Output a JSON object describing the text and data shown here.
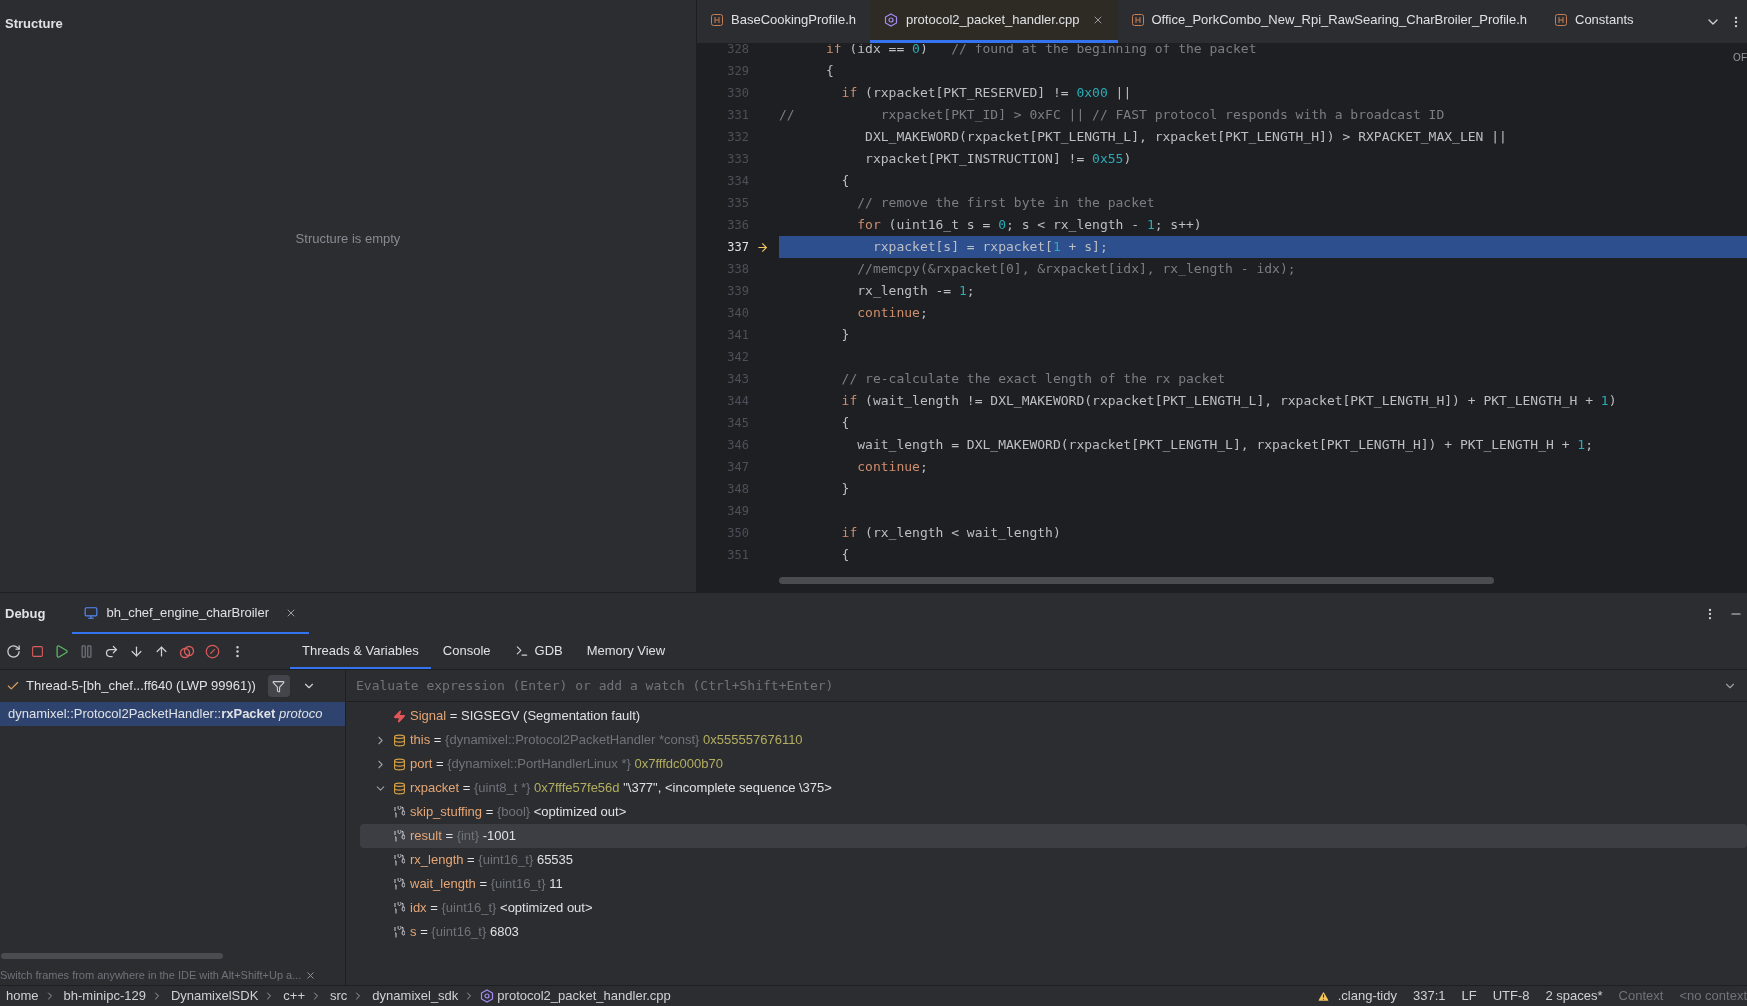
{
  "structure": {
    "title": "Structure",
    "empty_text": "Structure is empty"
  },
  "editor": {
    "tabs": [
      {
        "label": "BaseCookingProfile.h",
        "kind": "header",
        "selected": false,
        "closable": false
      },
      {
        "label": "protocol2_packet_handler.cpp",
        "kind": "source",
        "selected": true,
        "closable": true
      },
      {
        "label": "Office_PorkCombo_New_Rpi_RawSearing_CharBroiler_Profile.h",
        "kind": "header",
        "selected": false,
        "closable": false
      },
      {
        "label": "Constants",
        "kind": "header",
        "selected": false,
        "closable": false
      }
    ],
    "corner_label": "OF",
    "lines": [
      {
        "number": "328",
        "current": false,
        "tokens": [
          {
            "kind": "kw",
            "text": "      if"
          },
          {
            "kind": "plain",
            "text": " (idx == "
          },
          {
            "kind": "num",
            "text": "0"
          },
          {
            "kind": "plain",
            "text": ")   "
          },
          {
            "kind": "comment",
            "text": "// found at the beginning of the packet"
          }
        ]
      },
      {
        "number": "329",
        "current": false,
        "tokens": [
          {
            "kind": "plain",
            "text": "      {"
          }
        ]
      },
      {
        "number": "330",
        "current": false,
        "tokens": [
          {
            "kind": "kw",
            "text": "        if"
          },
          {
            "kind": "plain",
            "text": " (rxpacket[PKT_RESERVED] != "
          },
          {
            "kind": "num",
            "text": "0x00"
          },
          {
            "kind": "plain",
            "text": " ||"
          }
        ]
      },
      {
        "number": "331",
        "current": false,
        "tokens": [
          {
            "kind": "comment",
            "text": "//           rxpacket[PKT_ID] > 0xFC || // FAST protocol responds with a broadcast ID"
          }
        ]
      },
      {
        "number": "332",
        "current": false,
        "tokens": [
          {
            "kind": "plain",
            "text": "           DXL_MAKEWORD(rxpacket[PKT_LENGTH_L], rxpacket[PKT_LENGTH_H]) > RXPACKET_MAX_LEN ||"
          }
        ]
      },
      {
        "number": "333",
        "current": false,
        "tokens": [
          {
            "kind": "plain",
            "text": "           rxpacket[PKT_INSTRUCTION] != "
          },
          {
            "kind": "num",
            "text": "0x55"
          },
          {
            "kind": "plain",
            "text": ")"
          }
        ]
      },
      {
        "number": "334",
        "current": false,
        "tokens": [
          {
            "kind": "plain",
            "text": "        {"
          }
        ]
      },
      {
        "number": "335",
        "current": false,
        "tokens": [
          {
            "kind": "comment",
            "text": "          // remove the first byte in the packet"
          }
        ]
      },
      {
        "number": "336",
        "current": false,
        "tokens": [
          {
            "kind": "kw",
            "text": "          for"
          },
          {
            "kind": "plain",
            "text": " (uint16_t s = "
          },
          {
            "kind": "num",
            "text": "0"
          },
          {
            "kind": "plain",
            "text": "; s < rx_length - "
          },
          {
            "kind": "num",
            "text": "1"
          },
          {
            "kind": "plain",
            "text": "; s++)"
          }
        ]
      },
      {
        "number": "337",
        "current": true,
        "tokens": [
          {
            "kind": "plain",
            "text": "            rxpacket[s] = rxpacket["
          },
          {
            "kind": "num",
            "text": "1"
          },
          {
            "kind": "plain",
            "text": " + s];"
          }
        ]
      },
      {
        "number": "338",
        "current": false,
        "tokens": [
          {
            "kind": "comment",
            "text": "          //memcpy(&rxpacket[0], &rxpacket[idx], rx_length - idx);"
          }
        ]
      },
      {
        "number": "339",
        "current": false,
        "tokens": [
          {
            "kind": "plain",
            "text": "          rx_length -= "
          },
          {
            "kind": "num",
            "text": "1"
          },
          {
            "kind": "plain",
            "text": ";"
          }
        ]
      },
      {
        "number": "340",
        "current": false,
        "tokens": [
          {
            "kind": "kw",
            "text": "          continue"
          },
          {
            "kind": "plain",
            "text": ";"
          }
        ]
      },
      {
        "number": "341",
        "current": false,
        "tokens": [
          {
            "kind": "plain",
            "text": "        }"
          }
        ]
      },
      {
        "number": "342",
        "current": false
      },
      {
        "number": "343",
        "current": false,
        "tokens": [
          {
            "kind": "comment",
            "text": "        // re-calculate the exact length of the rx packet"
          }
        ]
      },
      {
        "number": "344",
        "current": false,
        "tokens": [
          {
            "kind": "kw",
            "text": "        if"
          },
          {
            "kind": "plain",
            "text": " (wait_length != DXL_MAKEWORD(rxpacket[PKT_LENGTH_L], rxpacket[PKT_LENGTH_H]) + PKT_LENGTH_H + "
          },
          {
            "kind": "num",
            "text": "1"
          },
          {
            "kind": "plain",
            "text": ")"
          }
        ]
      },
      {
        "number": "345",
        "current": false,
        "tokens": [
          {
            "kind": "plain",
            "text": "        {"
          }
        ]
      },
      {
        "number": "346",
        "current": false,
        "tokens": [
          {
            "kind": "plain",
            "text": "          wait_length = DXL_MAKEWORD(rxpacket[PKT_LENGTH_L], rxpacket[PKT_LENGTH_H]) + PKT_LENGTH_H + "
          },
          {
            "kind": "num",
            "text": "1"
          },
          {
            "kind": "plain",
            "text": ";"
          }
        ]
      },
      {
        "number": "347",
        "current": false,
        "tokens": [
          {
            "kind": "kw",
            "text": "          continue"
          },
          {
            "kind": "plain",
            "text": ";"
          }
        ]
      },
      {
        "number": "348",
        "current": false,
        "tokens": [
          {
            "kind": "plain",
            "text": "        }"
          }
        ]
      },
      {
        "number": "349",
        "current": false
      },
      {
        "number": "350",
        "current": false,
        "tokens": [
          {
            "kind": "kw",
            "text": "        if"
          },
          {
            "kind": "plain",
            "text": " (rx_length < wait_length)"
          }
        ]
      },
      {
        "number": "351",
        "current": false,
        "tokens": [
          {
            "kind": "plain",
            "text": "        {"
          }
        ]
      }
    ]
  },
  "debug": {
    "title": "Debug",
    "session_tab": {
      "label": "bh_chef_engine_charBroiler",
      "selected": true
    },
    "view_tabs": [
      {
        "label": "Threads & Variables",
        "selected": true,
        "kind": "plain"
      },
      {
        "label": "Console",
        "selected": false,
        "kind": "plain"
      },
      {
        "label": "GDB",
        "selected": false,
        "kind": "terminal"
      },
      {
        "label": "Memory View",
        "selected": false,
        "kind": "plain"
      }
    ],
    "thread": {
      "label": "Thread-5-[bh_chef...ff640 (LWP 99961))"
    },
    "frames": [
      {
        "text": "dynamixel::Protocol2PacketHandler::**rxPacket** *protoco*",
        "selected": true
      }
    ],
    "evaluate_placeholder": "Evaluate expression (Enter) or add a watch (Ctrl+Shift+Enter)",
    "variables": [
      {
        "kind": "signal",
        "name": "Signal",
        "operator": "=",
        "value": "SIGSEGV (Segmentation fault)",
        "selected": false
      },
      {
        "kind": "pointer",
        "name": "this",
        "operator": "=",
        "type": "{dynamixel::Protocol2PacketHandler *const}",
        "value": "0x555557676110",
        "expanded": false,
        "selected": false
      },
      {
        "kind": "pointer",
        "name": "port",
        "operator": "=",
        "type": "{dynamixel::PortHandlerLinux *}",
        "value": "0x7fffdc000b70",
        "expanded": false,
        "selected": false
      },
      {
        "kind": "pointer",
        "name": "rxpacket",
        "operator": "=",
        "type": "{uint8_t *}",
        "value": "0x7fffe57fe56d",
        "extra": "\"\\377\", <incomplete sequence \\375>",
        "expanded": true,
        "selected": false
      },
      {
        "kind": "primitive",
        "name": "skip_stuffing",
        "operator": "=",
        "type": "{bool}",
        "value": "<optimized out>",
        "selected": false
      },
      {
        "kind": "primitive",
        "name": "result",
        "operator": "=",
        "type": "{int}",
        "value": "-1001",
        "selected": true
      },
      {
        "kind": "primitive",
        "name": "rx_length",
        "operator": "=",
        "type": "{uint16_t}",
        "value": "65535",
        "selected": false
      },
      {
        "kind": "primitive",
        "name": "wait_length",
        "operator": "=",
        "type": "{uint16_t}",
        "value": "11",
        "selected": false
      },
      {
        "kind": "primitive",
        "name": "idx",
        "operator": "=",
        "type": "{uint16_t}",
        "value": "<optimized out>",
        "selected": false
      },
      {
        "kind": "primitive",
        "name": "s",
        "operator": "=",
        "type": "{uint16_t}",
        "value": "6803",
        "selected": false
      }
    ],
    "hint": "Switch frames from anywhere in the IDE with Alt+Shift+Up a..."
  },
  "status_bar": {
    "breadcrumbs": [
      "home",
      "bh-minipc-129",
      "DynamixelSDK",
      "c++",
      "src",
      "dynamixel_sdk",
      "protocol2_packet_handler.cpp"
    ],
    "items": [
      {
        "text": ".clang-tidy",
        "kind": "warning"
      },
      {
        "text": "337:1",
        "kind": "plain"
      },
      {
        "text": "LF",
        "kind": "plain"
      },
      {
        "text": "UTF-8",
        "kind": "plain"
      },
      {
        "text": "2 spaces*",
        "kind": "plain"
      },
      {
        "text": "Context",
        "kind": "muted"
      },
      {
        "text": "<no context",
        "kind": "muted"
      }
    ]
  }
}
